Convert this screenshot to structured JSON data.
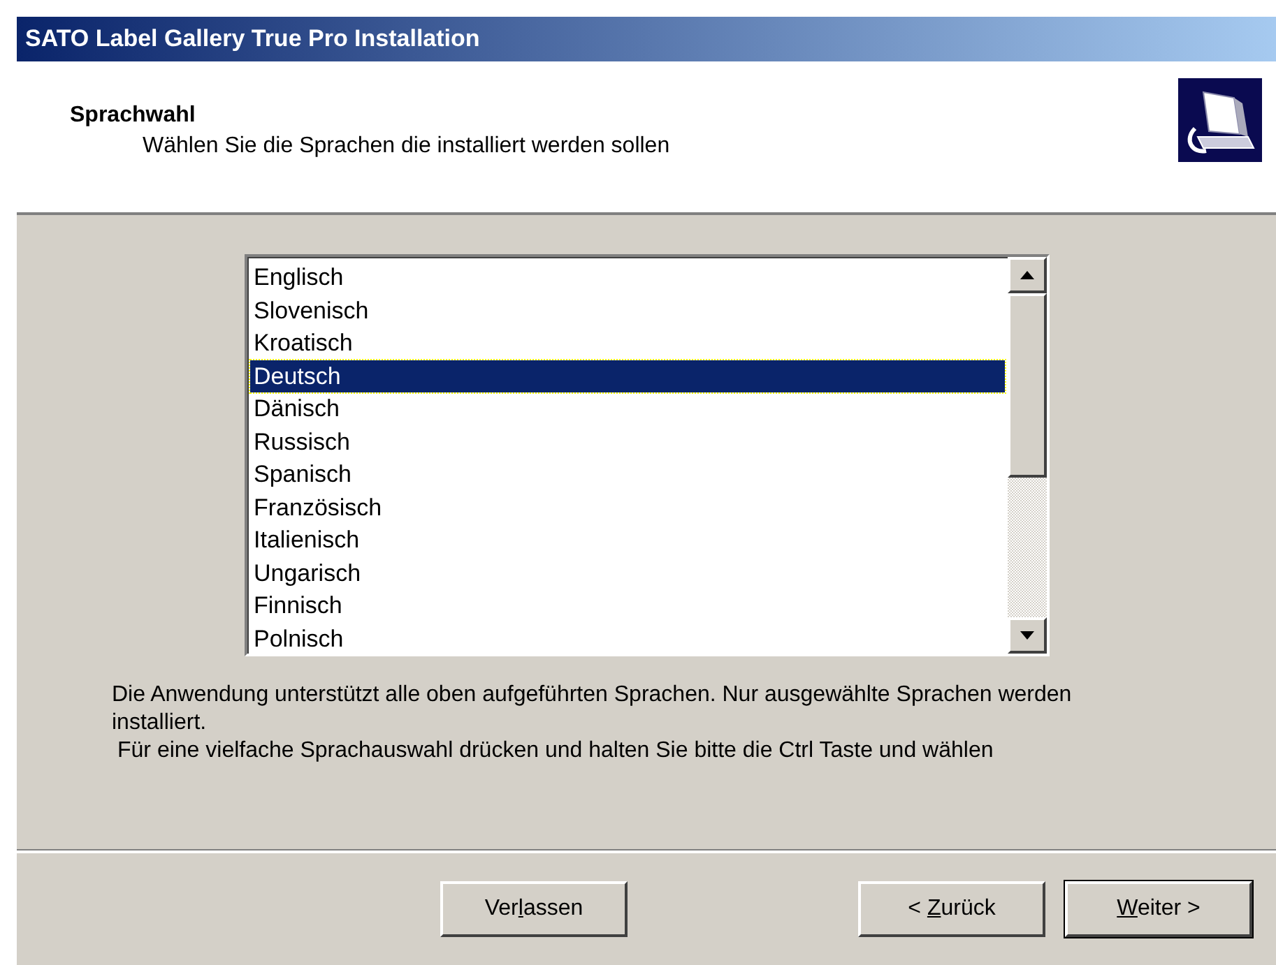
{
  "window": {
    "title": "SATO Label Gallery True Pro Installation"
  },
  "header": {
    "title": "Sprachwahl",
    "subtitle": "Wählen Sie die Sprachen die installiert werden sollen"
  },
  "languages": [
    {
      "label": "Englisch",
      "selected": false
    },
    {
      "label": "Slovenisch",
      "selected": false
    },
    {
      "label": "Kroatisch",
      "selected": false
    },
    {
      "label": "Deutsch",
      "selected": true
    },
    {
      "label": "Dänisch",
      "selected": false
    },
    {
      "label": "Russisch",
      "selected": false
    },
    {
      "label": "Spanisch",
      "selected": false
    },
    {
      "label": "Französisch",
      "selected": false
    },
    {
      "label": "Italienisch",
      "selected": false
    },
    {
      "label": "Ungarisch",
      "selected": false
    },
    {
      "label": "Finnisch",
      "selected": false
    },
    {
      "label": "Polnisch",
      "selected": false
    }
  ],
  "info": [
    "Die Anwendung unterstützt alle oben aufgeführten Sprachen. Nur ausgewählte Sprachen werden installiert.",
    "Für eine vielfache Sprachauswahl drücken und halten Sie bitte die Ctrl Taste und wählen"
  ],
  "buttons": [
    {
      "before": "Ver",
      "key": "l",
      "after": "assen",
      "default": false
    },
    {
      "before": "< ",
      "key": "Z",
      "after": "urück",
      "default": false
    },
    {
      "key": "W",
      "after": "eiter >",
      "default": true
    }
  ]
}
